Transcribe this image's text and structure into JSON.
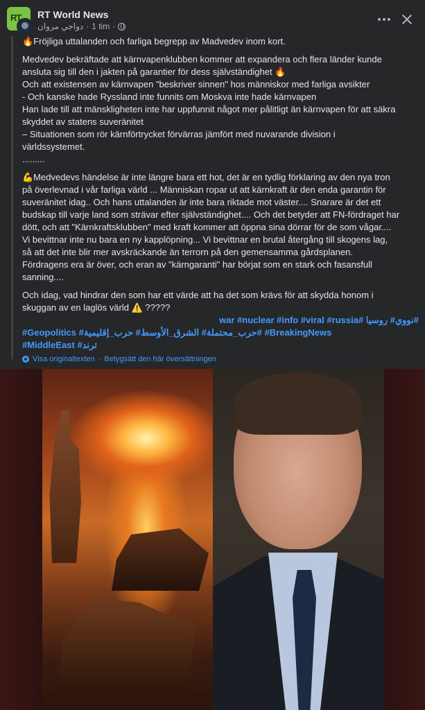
{
  "header": {
    "page_name": "RT World News",
    "author": "دواجي مروان",
    "time": "1 tim",
    "separator": "·"
  },
  "post": {
    "text_1": "🔥Fröjliga uttalanden och farliga begrepp av Madvedev inom kort.",
    "text_2": "Medvedev bekräftade att kärnvapenklubben kommer att expandera och flera länder kunde\nansluta sig till den i jakten på garantier för dess självständighet 🔥\nOch att existensen av kärnvapen \"beskriver sinnen\" hos människor med farliga avsikter\n- Och kanske hade Ryssland inte funnits om Moskva inte hade kärnvapen\nHan lade till att mänskligheten inte har uppfunnit något mer pålitligt än kärnvapen för att säkra\nskyddet av statens suveränitet\n– Situationen som rör kärnförtrycket förvärras jämfört med nuvarande division i\nvärldssystemet.\n.........",
    "text_3": "💪Medvedevs händelse är inte längre bara ett hot, det är en tydlig förklaring av den nya tron\npå överlevnad i vår farliga värld ... Människan ropar ut att kärnkraft är den enda garantin för\nsuveränitet idag.. Och hans uttalanden är inte bara riktade mot väster.... Snarare är det ett\nbudskap till varje land som strävar efter självständighet.... Och det betyder att FN-fördraget har\ndött, och att \"Kärnkraftsklubben\" med kraft kommer att öppna sina dörrar för de som vågar....\nVi bevittnar inte nu bara en ny kapplöpning... Vi bevittnar en brutal återgång till skogens lag,\nså att det inte blir mer avskräckande än terrorn på den gemensamma gårdsplanen.\nFördragens era är över, och eran av \"kärngaranti\" har börjat som en stark och fasansfull\nsanning....",
    "text_4": "Och idag, vad hindrar den som har ett värde att ha det som krävs för att skydda honom i\nskuggan av en laglös värld ⚠️ ?????",
    "hashtags_line1": "war #nuclear #info #viral #russia# نووي# روسيا#",
    "hashtags_line2": "#Geopolitics  #حرب_محتملة#  الشرق_الأوسط#  حرب_إقليمية#  #BreakingNews",
    "hashtags_line3": "#MiddleEast  #ترند",
    "see_original": "Visa originaltexten",
    "dot": "·",
    "rate_translation": "Betygsätt den här översättningen"
  },
  "icons": {
    "page_avatar": "rt-logo-icon",
    "globe": "globe-icon",
    "more": "more-options-icon",
    "close": "close-icon",
    "translate": "gear-icon"
  },
  "colors": {
    "background": "#252728",
    "text": "#e4e6eb",
    "secondary_text": "#b0b3b8",
    "link": "#4599ff",
    "rt_green": "#7cc242"
  }
}
